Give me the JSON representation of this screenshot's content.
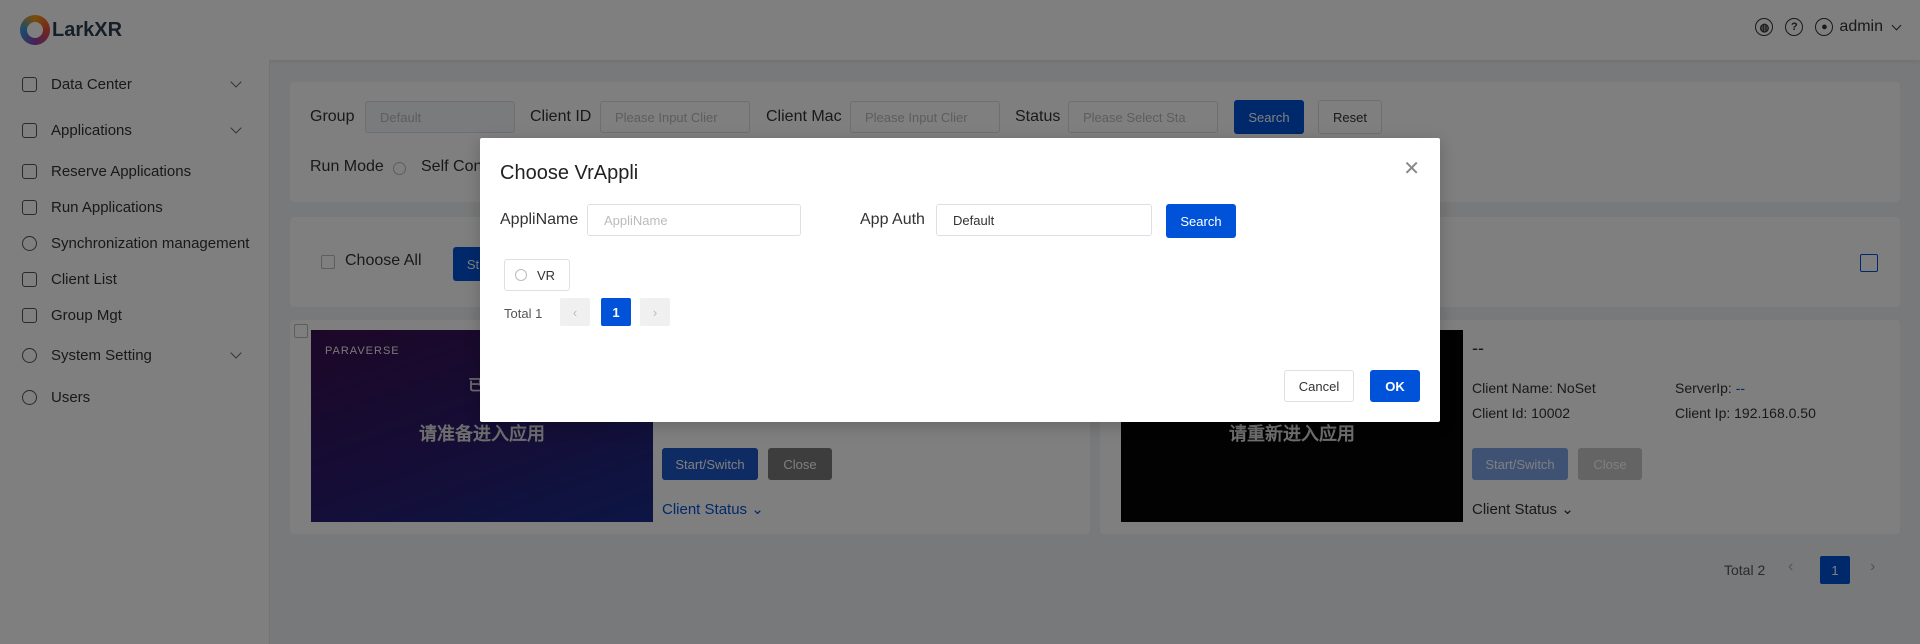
{
  "app": {
    "title": "LarkXR",
    "user": "admin"
  },
  "sidebar": {
    "items": [
      {
        "label": "Data Center",
        "expandable": true
      },
      {
        "label": "Applications",
        "expandable": true
      },
      {
        "label": "Reserve Applications"
      },
      {
        "label": "Run Applications"
      },
      {
        "label": "Synchronization management"
      },
      {
        "label": "Client List"
      },
      {
        "label": "Group Mgt"
      },
      {
        "label": "System Setting",
        "expandable": true
      },
      {
        "label": "Users"
      }
    ]
  },
  "filters": {
    "group_label": "Group",
    "group_value": "Default",
    "client_id_label": "Client ID",
    "client_id_placeholder": "Please Input Clier",
    "client_mac_label": "Client Mac",
    "client_mac_placeholder": "Please Input Clier",
    "status_label": "Status",
    "status_placeholder": "Please Select Sta",
    "search_label": "Search",
    "reset_label": "Reset",
    "run_mode_label": "Run Mode",
    "run_mode_option": "Self Cont"
  },
  "toolbar": {
    "choose_all": "Choose All",
    "partial_button": "St"
  },
  "clients": [
    {
      "thumb_brand": "PARAVERSE",
      "thumb_text_top": "已...",
      "thumb_text": "请准备进入应用",
      "start_label": "Start/Switch",
      "close_label": "Close",
      "status_label": "Client Status"
    },
    {
      "title": "--",
      "thumb_text": "请重新进入应用",
      "client_name": "Client Name: NoSet",
      "server_ip_label": "ServerIp:",
      "server_ip_value": "--",
      "client_id": "Client Id: 10002",
      "client_ip": "Client Ip: 192.168.0.50",
      "start_label": "Start/Switch",
      "close_label": "Close",
      "status_label": "Client Status"
    }
  ],
  "pagination": {
    "total": "Total 2",
    "page": "1"
  },
  "dialog": {
    "title": "Choose VrAppli",
    "appliname_label": "AppliName",
    "appliname_placeholder": "AppliName",
    "app_auth_label": "App Auth",
    "app_auth_value": "Default",
    "search_label": "Search",
    "vr_option": "VR",
    "total": "Total 1",
    "page": "1",
    "cancel_label": "Cancel",
    "ok_label": "OK"
  },
  "colors": {
    "primary": "#0052d9",
    "status_link": "#0052d9"
  }
}
